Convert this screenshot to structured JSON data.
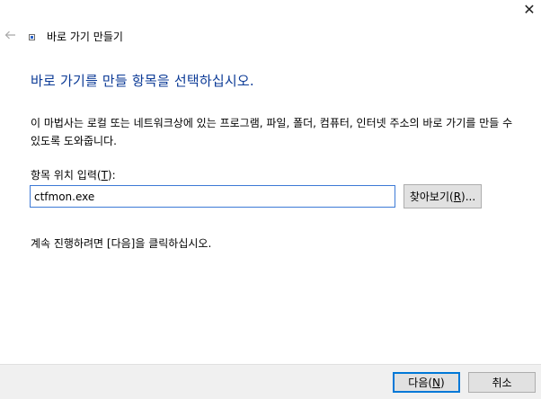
{
  "window": {
    "title": "바로 가기 만들기",
    "close_glyph": "✕"
  },
  "page": {
    "heading": "바로 가기를 만들 항목을 선택하십시오.",
    "description": "이 마법사는 로컬 또는 네트워크상에 있는 프로그램, 파일, 폴더, 컴퓨터, 인터넷 주소의 바로 가기를 만들 수 있도록 도와줍니다.",
    "location_label_prefix": "항목 위치 입력(",
    "location_label_accel": "T",
    "location_label_suffix": "):",
    "location_value": "ctfmon.exe",
    "instruction": "계속 진행하려면 [다음]을 클릭하십시오."
  },
  "buttons": {
    "browse_prefix": "찾아보기(",
    "browse_accel": "R",
    "browse_suffix": ")...",
    "next_prefix": "다음(",
    "next_accel": "N",
    "next_suffix": ")",
    "cancel": "취소"
  },
  "colors": {
    "heading": "#0b3a96",
    "input_border_focus": "#3d7ad6",
    "default_button_border": "#0078d7",
    "footer_bg": "#f0f0f0"
  },
  "icons": {
    "close": "close-icon",
    "back": "back-arrow-icon",
    "title": "shortcut-icon"
  }
}
